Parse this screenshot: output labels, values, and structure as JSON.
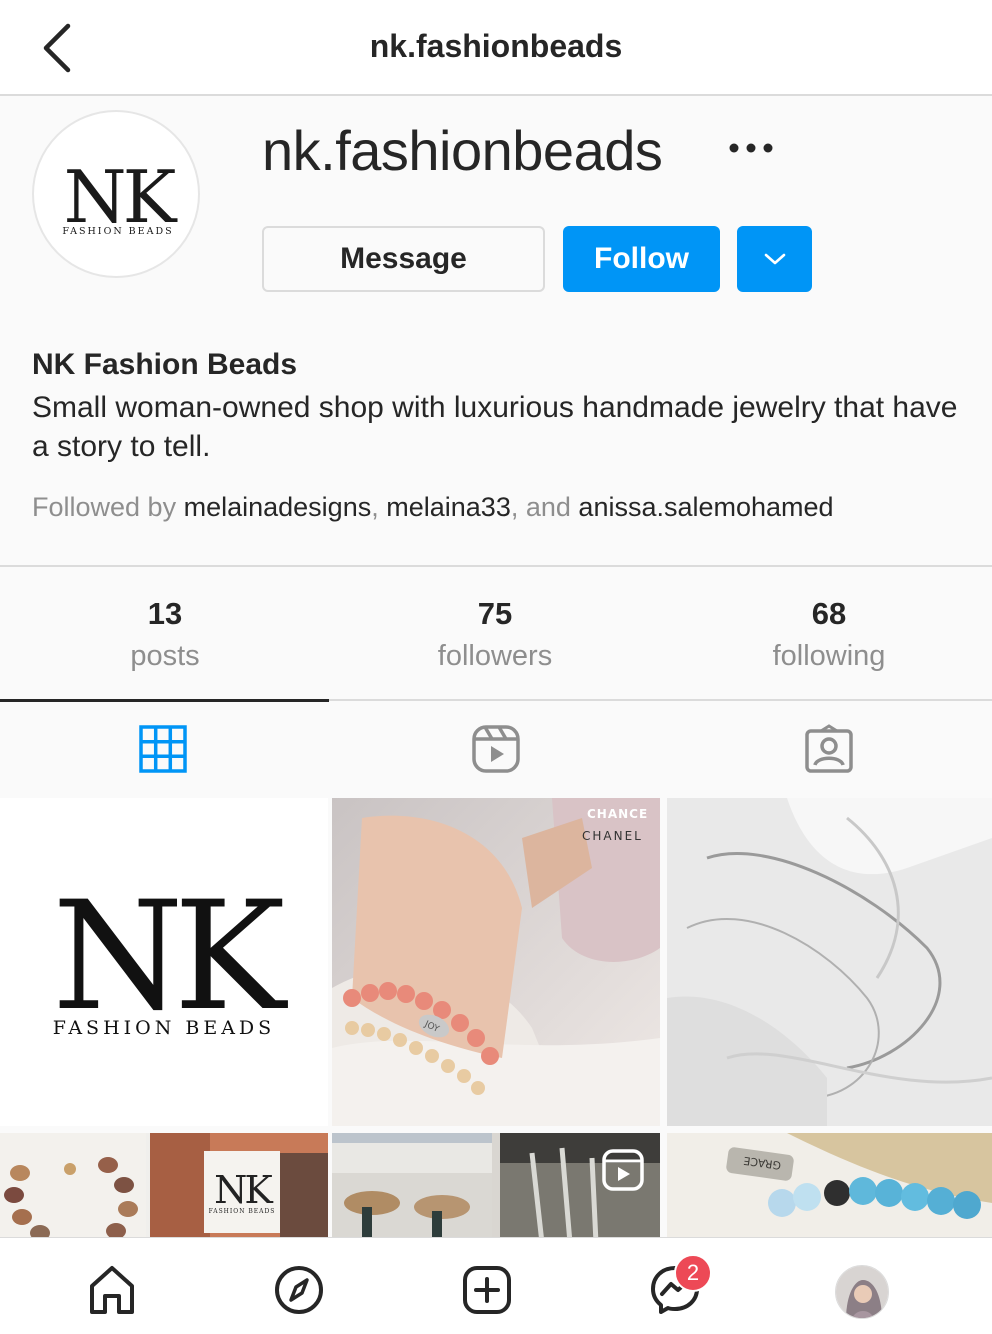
{
  "header": {
    "title": "nk.fashionbeads",
    "back_icon": "chevron-left-icon"
  },
  "profile": {
    "username": "nk.fashionbeads",
    "logo_text": "NK",
    "logo_subtext": "FASHION BEADS",
    "message_label": "Message",
    "follow_label": "Follow",
    "full_name": "NK Fashion Beads",
    "bio": "Small woman-owned shop with luxurious handmade jewelry that have a story to tell.",
    "followed_by_prefix": "Followed by",
    "followed_by": [
      "melainadesigns",
      "melaina33",
      "anissa.salemohamed"
    ],
    "followed_by_sep1": ",",
    "followed_by_sep2": ", and"
  },
  "stats": [
    {
      "value": "13",
      "label": "posts"
    },
    {
      "value": "75",
      "label": "followers"
    },
    {
      "value": "68",
      "label": "following"
    }
  ],
  "tabs": [
    "grid-icon",
    "reels-icon",
    "tagged-icon"
  ],
  "grid": {
    "tile1_logo": "NK",
    "tile1_sub": "FASHION BEADS",
    "tile2_text1": "CHANCE",
    "tile2_text2": "CHANEL",
    "tile2_bead_word": "JOY",
    "tile6_tag": "GRACE",
    "tile5b_logo": "NK",
    "tile5b_sub": "FASHION BEADS"
  },
  "bottom_nav": {
    "items": [
      "home-icon",
      "explore-icon",
      "new-post-icon",
      "messenger-icon",
      "profile-avatar"
    ],
    "messenger_badge": "2"
  },
  "colors": {
    "accent": "#0095f6",
    "badge": "#ed4956"
  }
}
